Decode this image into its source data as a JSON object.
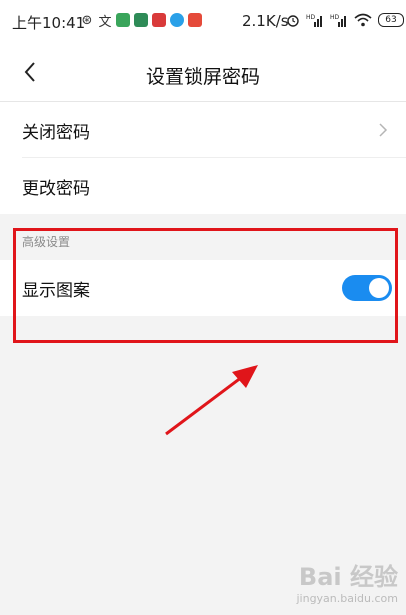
{
  "status_bar": {
    "time": "上午10:41",
    "network_speed": "2.1K/s",
    "battery": "63",
    "icons_left": [
      "weibo-icon",
      "translate-icon",
      "app-icon-green",
      "app-icon-darkgreen",
      "app-icon-red",
      "app-icon-blue",
      "app-icon-red2"
    ],
    "icons_right": [
      "alarm-icon",
      "signal-hd-icon",
      "signal-hd-icon",
      "wifi-icon",
      "battery-icon"
    ]
  },
  "title_bar": {
    "back_icon": "chevron-left-icon",
    "title": "设置锁屏密码"
  },
  "settings": {
    "items": [
      {
        "label": "关闭密码",
        "icon": "chevron-right-icon"
      },
      {
        "label": "更改密码"
      }
    ]
  },
  "advanced": {
    "section_title": "高级设置",
    "toggle_label": "显示图案",
    "toggle_on": true,
    "toggle_color": "#1a8cf0"
  },
  "annotation": {
    "box_color": "#e0151a",
    "arrow_color": "#e0151a"
  },
  "watermark": {
    "main": "Bai 经验",
    "sub": "jingyan.baidu.com"
  }
}
